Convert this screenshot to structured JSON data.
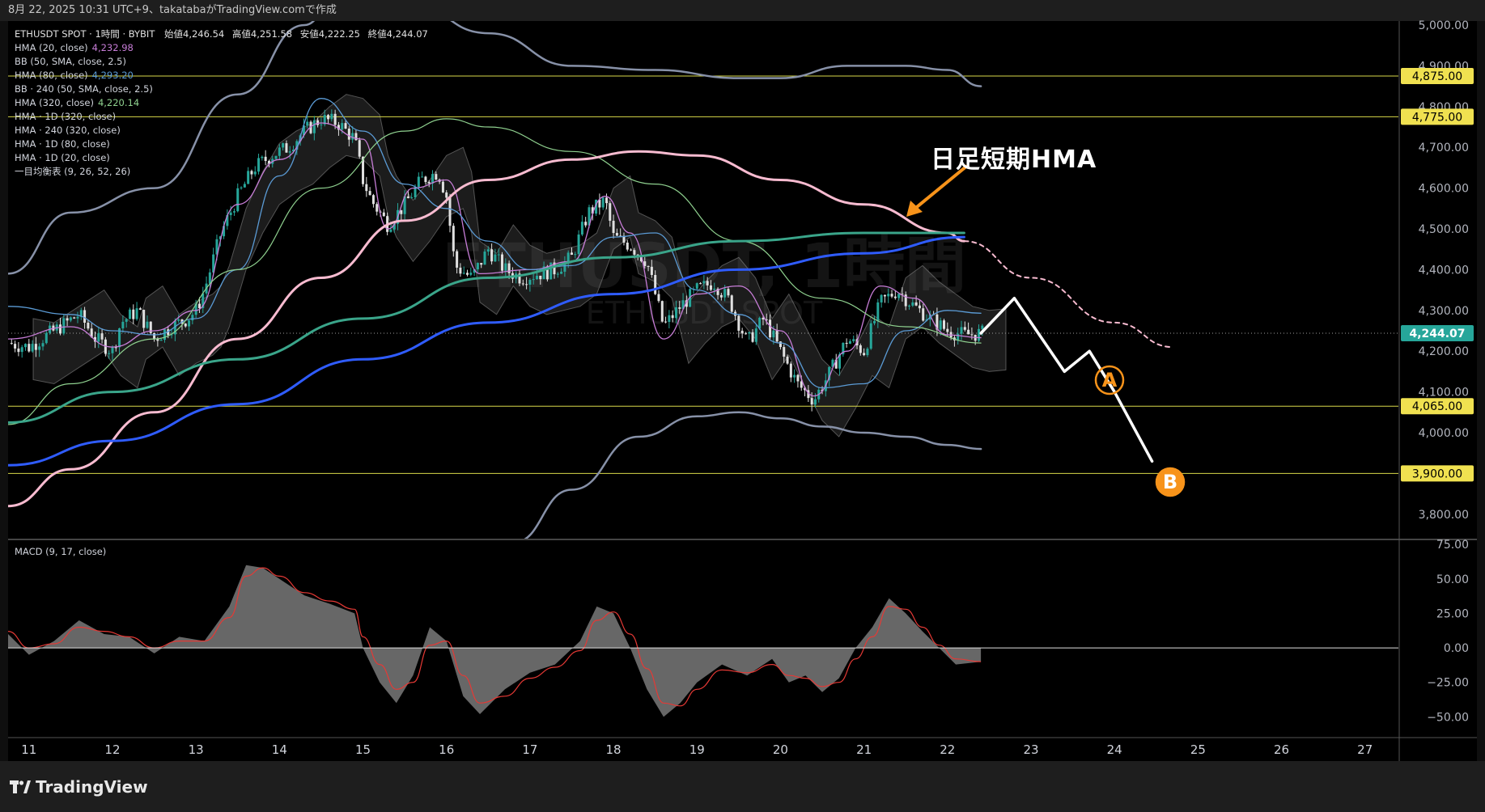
{
  "header": {
    "text": "8月 22, 2025 10:31 UTC+9、takatabaがTradingView.comで作成"
  },
  "legend": {
    "symbol_line": "ETHUSDT SPOT · 1時間 · BYBIT",
    "open_label": "始値",
    "open": "4,246.54",
    "high_label": "高値",
    "high": "4,251.58",
    "low_label": "安値",
    "low": "4,222.25",
    "close_label": "終値",
    "close": "4,244.07",
    "indicators": [
      {
        "name": "HMA (20, close)",
        "value": "4,232.98",
        "color": "#c77dd7"
      },
      {
        "name": "BB (50, SMA, close, 2.5)",
        "value": "",
        "color": "#d1d4dc"
      },
      {
        "name": "HMA (80, close)",
        "value": "4,293.20",
        "color": "#5b9bd5"
      },
      {
        "name": "BB · 240 (50, SMA, close, 2.5)",
        "value": "",
        "color": "#d1d4dc"
      },
      {
        "name": "HMA (320, close)",
        "value": "4,220.14",
        "color": "#8fd18f"
      },
      {
        "name": "HMA · 1D (320, close)",
        "value": "",
        "color": "#d1d4dc"
      },
      {
        "name": "HMA · 240 (320, close)",
        "value": "",
        "color": "#d1d4dc"
      },
      {
        "name": "HMA · 1D (80, close)",
        "value": "",
        "color": "#d1d4dc"
      },
      {
        "name": "HMA · 1D (20, close)",
        "value": "",
        "color": "#d1d4dc"
      },
      {
        "name": "一目均衡表 (9, 26, 52, 26)",
        "value": "",
        "color": "#d1d4dc"
      }
    ]
  },
  "watermark": {
    "main": "ETHUSDT, 1時間",
    "sub": "ETHUSDT SPOT"
  },
  "annotation": {
    "text": "日足短期HMA",
    "point_a": "A",
    "point_b": "B"
  },
  "macd_label": "MACD (9, 17, close)",
  "logo_text": "TradingView",
  "colors": {
    "bull": "#26a69a",
    "bear": "#e0e0e0",
    "hline": "#d8d84a",
    "pink": "#f8bbd0",
    "blue": "#2f5cff",
    "teal": "#3aa58a",
    "arrow": "#f7931a"
  },
  "chart_data": {
    "type": "line",
    "title": "ETHUSDT SPOT · 1時間 · BYBIT",
    "ylim": [
      3740,
      5010
    ],
    "xlim": [
      10.75,
      27.4
    ],
    "x_ticks": [
      11,
      12,
      13,
      14,
      15,
      16,
      17,
      18,
      19,
      20,
      21,
      22,
      23,
      24,
      25,
      26,
      27
    ],
    "x_tick_labels": [
      "11",
      "12",
      "13",
      "14",
      "15",
      "16",
      "17",
      "18",
      "19",
      "20",
      "21",
      "22",
      "23",
      "24",
      "25",
      "26",
      "27"
    ],
    "y_ticks": [
      3800,
      3900,
      4000,
      4100,
      4200,
      4300,
      4400,
      4500,
      4600,
      4700,
      4800,
      4900,
      5000
    ],
    "y_tick_labels": [
      "3,800.00",
      "3,900.00",
      "4,000.00",
      "4,100.00",
      "4,200.00",
      "4,300.00",
      "4,400.00",
      "4,500.00",
      "4,600.00",
      "4,700.00",
      "4,800.00",
      "4,900.00",
      "5,000.00"
    ],
    "horizontal_levels": [
      {
        "value": 4875,
        "label": "4,875.00"
      },
      {
        "value": 4775,
        "label": "4,775.00"
      },
      {
        "value": 4065,
        "label": "4,065.00"
      },
      {
        "value": 3900,
        "label": "3,900.00"
      }
    ],
    "last_price": {
      "value": 4244.07,
      "label": "4,244.07"
    },
    "price_path": {
      "x": [
        10.75,
        11.0,
        11.3,
        11.6,
        11.8,
        12.0,
        12.1,
        12.3,
        12.5,
        12.7,
        12.9,
        13.0,
        13.1,
        13.3,
        13.5,
        13.7,
        13.9,
        14.1,
        14.3,
        14.5,
        14.7,
        14.9,
        15.0,
        15.1,
        15.3,
        15.5,
        15.7,
        15.9,
        16.0,
        16.1,
        16.3,
        16.5,
        16.7,
        16.9,
        17.1,
        17.3,
        17.5,
        17.7,
        17.9,
        18.0,
        18.2,
        18.4,
        18.6,
        18.8,
        19.0,
        19.2,
        19.4,
        19.6,
        19.8,
        20.0,
        20.2,
        20.4,
        20.6,
        20.8,
        21.0,
        21.2,
        21.4,
        21.6,
        21.8,
        22.0,
        22.2,
        22.4
      ],
      "close": [
        4220,
        4210,
        4250,
        4290,
        4230,
        4200,
        4270,
        4300,
        4230,
        4260,
        4280,
        4300,
        4350,
        4490,
        4580,
        4650,
        4680,
        4700,
        4740,
        4770,
        4760,
        4720,
        4620,
        4570,
        4510,
        4560,
        4620,
        4640,
        4580,
        4410,
        4380,
        4450,
        4400,
        4380,
        4390,
        4400,
        4430,
        4540,
        4570,
        4480,
        4460,
        4420,
        4260,
        4310,
        4350,
        4370,
        4320,
        4220,
        4280,
        4200,
        4120,
        4080,
        4150,
        4230,
        4200,
        4320,
        4350,
        4310,
        4280,
        4250,
        4240,
        4244
      ]
    },
    "series": [
      {
        "name": "HMA (20, close)",
        "color": "#c77dd7",
        "x": [
          10.75,
          11.5,
          12.0,
          12.5,
          13.0,
          13.5,
          14.0,
          14.5,
          15.0,
          15.3,
          15.6,
          16.0,
          16.4,
          17.0,
          17.5,
          17.9,
          18.2,
          18.6,
          19.0,
          19.5,
          20.0,
          20.4,
          20.8,
          21.2,
          21.6,
          22.0,
          22.4
        ],
        "values": [
          4230,
          4260,
          4210,
          4250,
          4300,
          4560,
          4670,
          4760,
          4720,
          4500,
          4600,
          4620,
          4390,
          4400,
          4420,
          4580,
          4490,
          4230,
          4340,
          4360,
          4250,
          4090,
          4200,
          4360,
          4330,
          4240,
          4233
        ]
      },
      {
        "name": "HMA (80, close)",
        "color": "#5b9bd5",
        "x": [
          10.75,
          11.5,
          12.0,
          12.5,
          13.0,
          13.5,
          14.0,
          14.5,
          15.0,
          15.5,
          16.0,
          16.5,
          17.0,
          17.5,
          18.0,
          18.5,
          19.0,
          19.5,
          20.0,
          20.5,
          21.0,
          21.5,
          22.0,
          22.4
        ],
        "values": [
          4310,
          4290,
          4250,
          4240,
          4280,
          4400,
          4630,
          4820,
          4740,
          4610,
          4550,
          4470,
          4400,
          4410,
          4480,
          4490,
          4350,
          4290,
          4220,
          4110,
          4120,
          4250,
          4300,
          4293
        ]
      },
      {
        "name": "HMA (320, close)",
        "color": "#8fd18f",
        "x": [
          10.75,
          11.5,
          12.5,
          13.5,
          14.5,
          15.5,
          16.0,
          16.5,
          17.5,
          18.5,
          19.5,
          20.5,
          21.5,
          22.4
        ],
        "values": [
          4020,
          4120,
          4230,
          4400,
          4600,
          4740,
          4770,
          4750,
          4690,
          4610,
          4470,
          4330,
          4260,
          4220
        ]
      },
      {
        "name": "HMA · 1D (20, close)",
        "color": "#f8bbd0",
        "x": [
          10.75,
          11.5,
          12.5,
          13.5,
          14.5,
          15.5,
          16.5,
          17.5,
          18.3,
          19.0,
          20.0,
          21.0,
          22.0,
          22.2
        ],
        "values": [
          3820,
          3910,
          4050,
          4230,
          4380,
          4520,
          4620,
          4670,
          4690,
          4680,
          4620,
          4560,
          4490,
          4470
        ]
      },
      {
        "name": "HMA · 1D (20, close) projection",
        "color": "#f8bbd0",
        "x": [
          22.2,
          23.0,
          24.0,
          24.7
        ],
        "values": [
          4470,
          4380,
          4270,
          4210
        ]
      },
      {
        "name": "HMA · 240 (320, close)",
        "color": "#3aa58a",
        "x": [
          10.75,
          12.0,
          13.5,
          15.0,
          16.5,
          18.0,
          19.5,
          21.0,
          22.2
        ],
        "values": [
          4025,
          4100,
          4180,
          4280,
          4380,
          4430,
          4470,
          4490,
          4490
        ]
      },
      {
        "name": "HMA · 1D (80, close)",
        "color": "#2f5cff",
        "x": [
          10.75,
          12.0,
          13.5,
          15.0,
          16.5,
          18.0,
          19.5,
          21.0,
          22.2
        ],
        "values": [
          3920,
          3980,
          4070,
          4180,
          4270,
          4340,
          4400,
          4440,
          4480
        ]
      },
      {
        "name": "BB · 240 upper",
        "color": "#8791a8",
        "x": [
          10.75,
          11.5,
          12.5,
          13.5,
          14.3,
          14.8,
          15.5,
          16.5,
          17.5,
          18.5,
          19.5,
          20.0,
          20.8,
          21.5,
          22.0,
          22.4
        ],
        "values": [
          4390,
          4540,
          4600,
          4830,
          5000,
          5130,
          5060,
          4980,
          4900,
          4890,
          4870,
          4870,
          4900,
          4900,
          4890,
          4850
        ]
      },
      {
        "name": "BB · 240 lower",
        "color": "#8791a8",
        "x": [
          16.8,
          17.5,
          18.3,
          19.0,
          19.5,
          20.0,
          20.5,
          21.0,
          21.5,
          22.0,
          22.4
        ],
        "values": [
          3730,
          3860,
          3990,
          4040,
          4050,
          4035,
          4015,
          4000,
          3990,
          3970,
          3960
        ]
      },
      {
        "name": "Scenario",
        "color": "#ffffff",
        "x": [
          22.4,
          22.8,
          23.4,
          23.7,
          24.0,
          24.45
        ],
        "values": [
          4244,
          4330,
          4150,
          4200,
          4100,
          3930
        ]
      }
    ],
    "macd": {
      "label": "MACD (9, 17, close)",
      "ylim": [
        -65,
        78
      ],
      "y_ticks": [
        75,
        50,
        25,
        0,
        -25,
        -50
      ],
      "y_tick_labels": [
        "75.00",
        "50.00",
        "25.00",
        "0.00",
        "−25.00",
        "−50.00"
      ],
      "x": [
        10.75,
        11.0,
        11.3,
        11.6,
        11.9,
        12.2,
        12.5,
        12.8,
        13.1,
        13.4,
        13.6,
        13.8,
        14.0,
        14.3,
        14.6,
        14.9,
        15.0,
        15.2,
        15.4,
        15.6,
        15.8,
        16.0,
        16.2,
        16.4,
        16.7,
        17.0,
        17.3,
        17.6,
        17.8,
        18.0,
        18.2,
        18.4,
        18.6,
        18.8,
        19.0,
        19.3,
        19.6,
        19.9,
        20.1,
        20.3,
        20.5,
        20.7,
        20.9,
        21.1,
        21.3,
        21.5,
        21.7,
        21.9,
        22.1,
        22.4
      ],
      "hist": [
        10,
        -5,
        5,
        20,
        10,
        8,
        -4,
        8,
        5,
        30,
        60,
        58,
        50,
        38,
        32,
        25,
        0,
        -25,
        -40,
        -20,
        15,
        5,
        -35,
        -48,
        -30,
        -18,
        -12,
        5,
        30,
        25,
        0,
        -30,
        -50,
        -40,
        -25,
        -12,
        -20,
        -8,
        -25,
        -20,
        -32,
        -22,
        0,
        15,
        36,
        25,
        12,
        0,
        -12,
        -10
      ],
      "signal": [
        12,
        0,
        3,
        15,
        12,
        8,
        0,
        5,
        5,
        22,
        52,
        58,
        52,
        40,
        34,
        28,
        8,
        -12,
        -30,
        -25,
        2,
        5,
        -20,
        -40,
        -35,
        -22,
        -14,
        -2,
        20,
        26,
        10,
        -15,
        -40,
        -42,
        -30,
        -16,
        -18,
        -12,
        -20,
        -22,
        -28,
        -25,
        -8,
        8,
        30,
        28,
        15,
        2,
        -8,
        -10
      ]
    }
  }
}
